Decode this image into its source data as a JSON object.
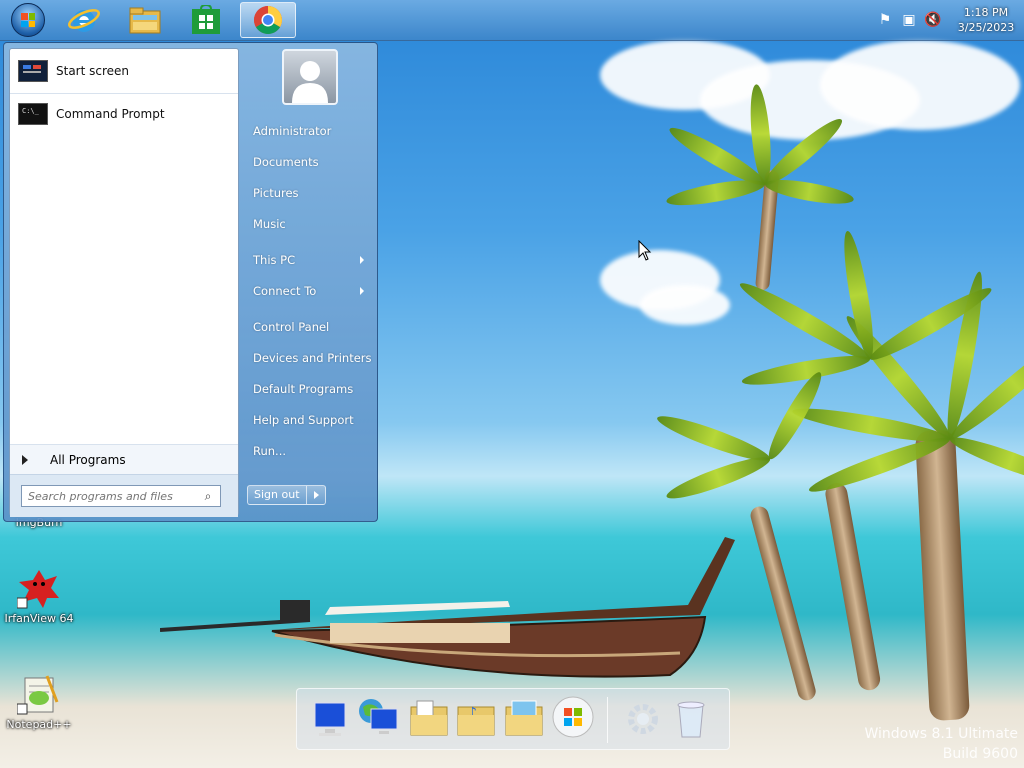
{
  "taskbar": {
    "pinned": [
      {
        "name": "start-orb-button"
      },
      {
        "name": "internet-explorer-icon"
      },
      {
        "name": "file-explorer-icon"
      },
      {
        "name": "store-icon"
      },
      {
        "name": "chrome-icon"
      }
    ],
    "clock_time": "1:18 PM",
    "clock_date": "3/25/2023"
  },
  "start_menu": {
    "programs": [
      {
        "label": "Start screen"
      },
      {
        "label": "Command Prompt"
      }
    ],
    "all_programs": "All Programs",
    "search_placeholder": "Search programs and files",
    "right": {
      "user": "Administrator",
      "documents": "Documents",
      "pictures": "Pictures",
      "music": "Music",
      "this_pc": "This PC",
      "connect_to": "Connect To",
      "control_panel": "Control Panel",
      "devices_printers": "Devices and Printers",
      "default_programs": "Default Programs",
      "help_support": "Help and Support",
      "run": "Run..."
    },
    "sign_out": "Sign out"
  },
  "desktop": {
    "icons": [
      {
        "label": "ImgBurn"
      },
      {
        "label": "IrfanView 64"
      },
      {
        "label": "Notepad++"
      }
    ]
  },
  "watermark": {
    "line1": "Windows 8.1 Ultimate",
    "line2": "Build 9600"
  }
}
